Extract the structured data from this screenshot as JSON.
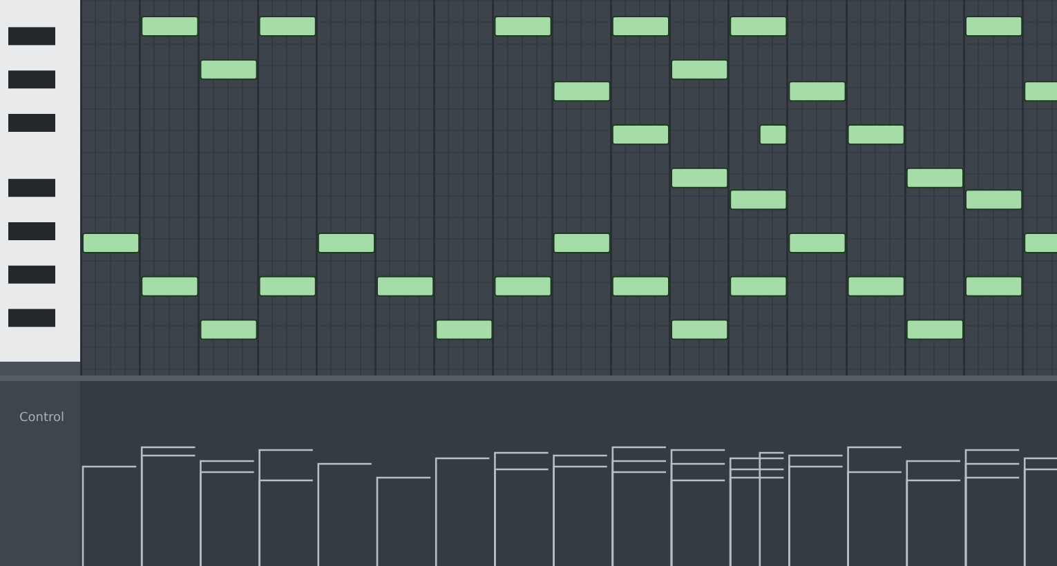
{
  "event_editor": {
    "label": "Control"
  }
}
